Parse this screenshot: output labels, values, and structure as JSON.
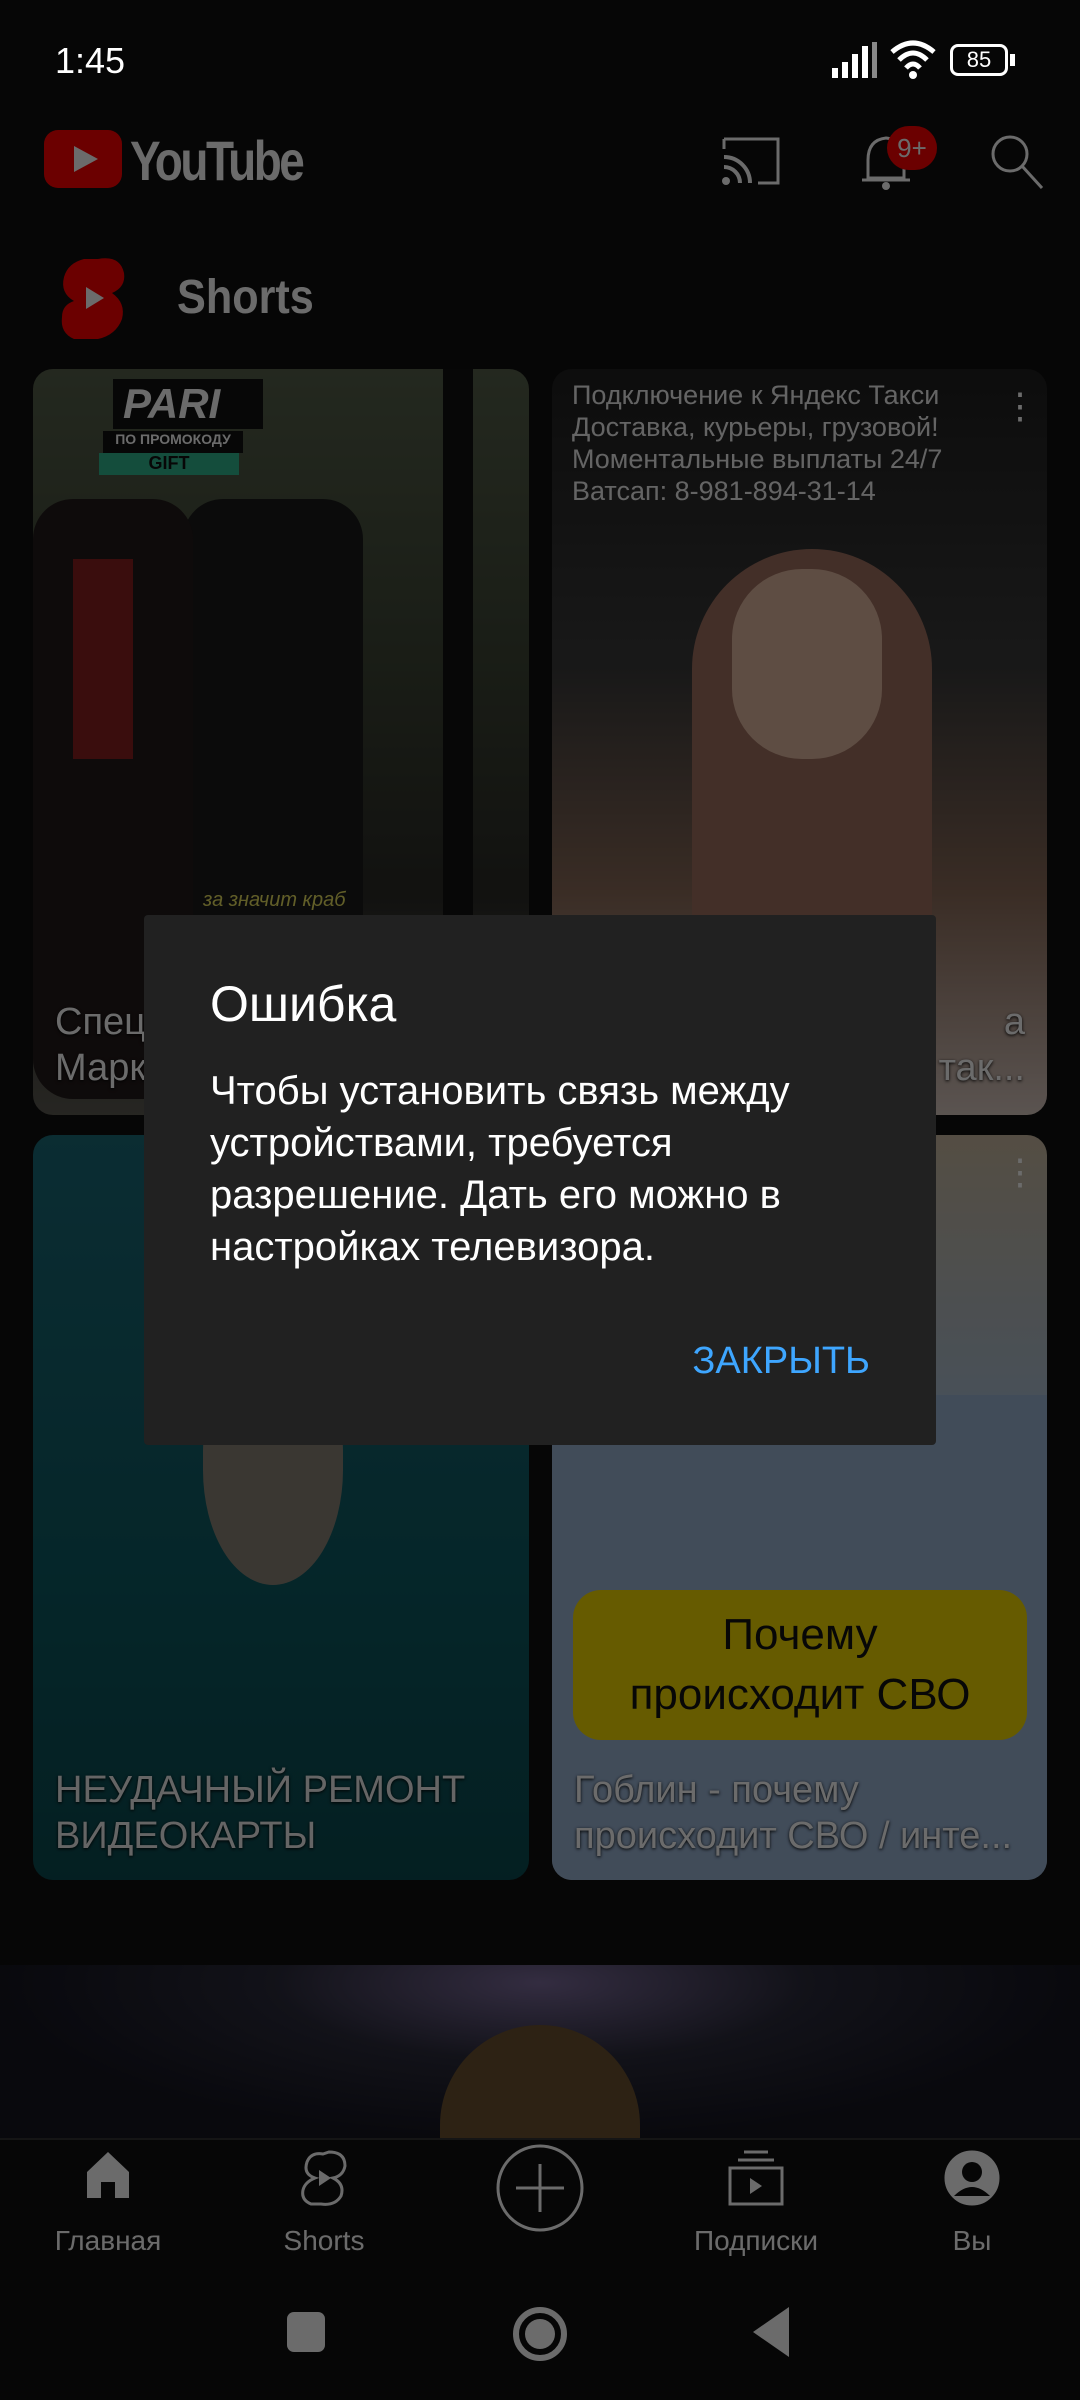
{
  "status_bar": {
    "time": "1:45",
    "battery": "85"
  },
  "header": {
    "logo_text": "YouTube",
    "notification_badge": "9+",
    "icons": [
      "cast-icon",
      "bell-icon",
      "search-icon"
    ]
  },
  "shorts": {
    "title": "Shorts",
    "cards": [
      {
        "overlay_brand": "PARI",
        "promo_label": "ПО ПРОМОКОДУ",
        "promo_code": "GIFT",
        "subtitle": "за значит краб",
        "title_line1": "Спец",
        "title_line2": "Марк"
      },
      {
        "overlay_lines": [
          "Подключение к Яндекс Такси",
          "Доставка, курьеры, грузовой!",
          "Моментальные выплаты 24/7",
          "Ватсап: 8-981-894-31-14"
        ],
        "title_line1": "а",
        "title_line2": "так..."
      },
      {
        "title": "НЕУДАЧНЫЙ РЕМОНТ ВИДЕОКАРТЫ"
      },
      {
        "banner": "Почему происходит СВО",
        "title": "Гоблин - почему происходит СВО / инте..."
      }
    ]
  },
  "dialog": {
    "title": "Ошибка",
    "body": "Чтобы установить связь между устройствами, требуется разрешение. Дать его можно в настройках телевизора.",
    "close_label": "ЗАКРЫТЬ",
    "accent": "#3ea6ff"
  },
  "bottom_nav": {
    "items": [
      {
        "label": "Главная"
      },
      {
        "label": "Shorts"
      },
      {
        "label": ""
      },
      {
        "label": "Подписки"
      },
      {
        "label": "Вы"
      }
    ]
  }
}
